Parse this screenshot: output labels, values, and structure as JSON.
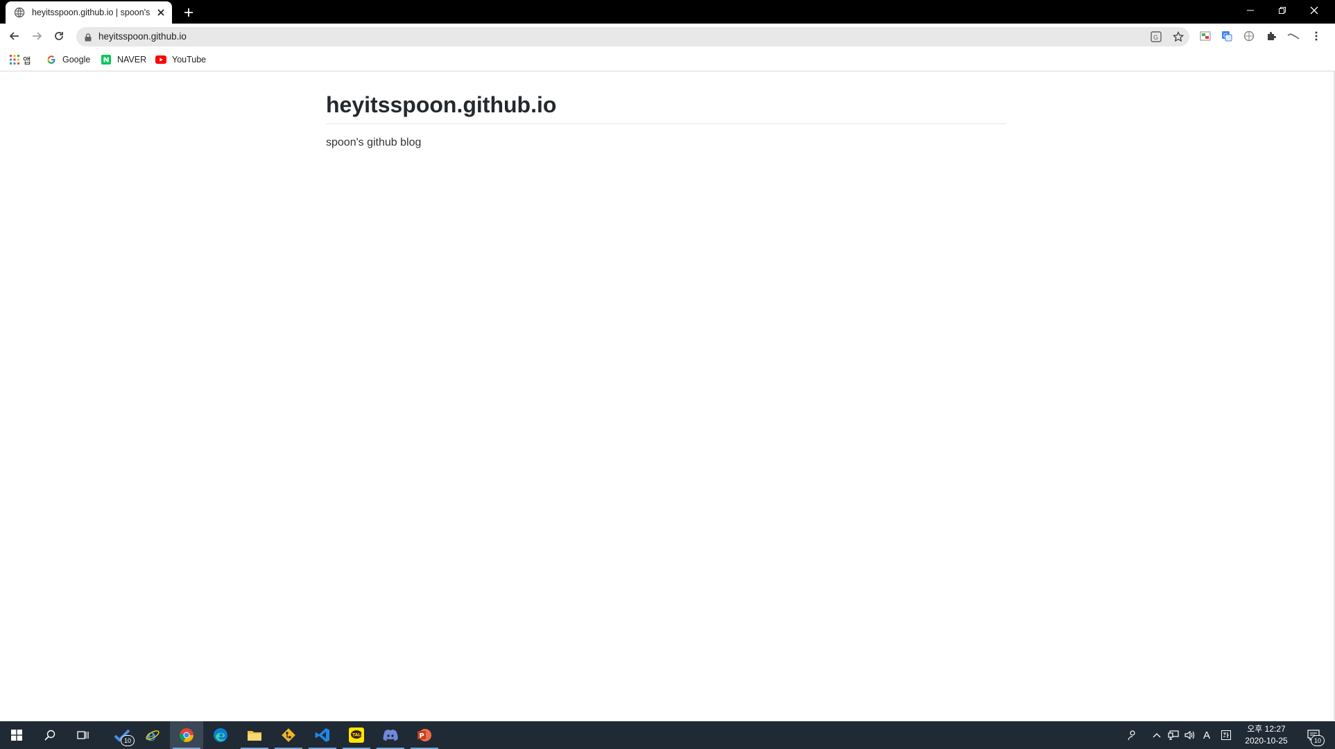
{
  "tab": {
    "title": "heyitsspoon.github.io | spoon's github blog",
    "close_label": "✕",
    "new_tab_label": "+"
  },
  "window_controls": {
    "minimize": "─",
    "restore": "❐",
    "close": "✕"
  },
  "toolbar": {
    "url": "heyitsspoon.github.io",
    "icons": [
      "back-icon",
      "forward-icon",
      "reload-icon",
      "lock-icon",
      "translate-icon",
      "star-icon",
      "extension-icons",
      "puzzle-icon",
      "menu-icon"
    ]
  },
  "bookmarks": {
    "apps_label": "앱",
    "items": [
      {
        "label": "Google"
      },
      {
        "label": "NAVER"
      },
      {
        "label": "YouTube"
      }
    ]
  },
  "page": {
    "title": "heyitsspoon.github.io",
    "description": "spoon's github blog"
  },
  "taskbar": {
    "todo_badge": "10",
    "notification_badge": "10",
    "ime_label": "A",
    "time": "오후 12:27",
    "date": "2020-10-25"
  },
  "colors": {
    "tabstrip": "#000000",
    "taskbar": "#1f2a35",
    "title_text": "#24292e",
    "omnibox": "#e8e8e8"
  }
}
